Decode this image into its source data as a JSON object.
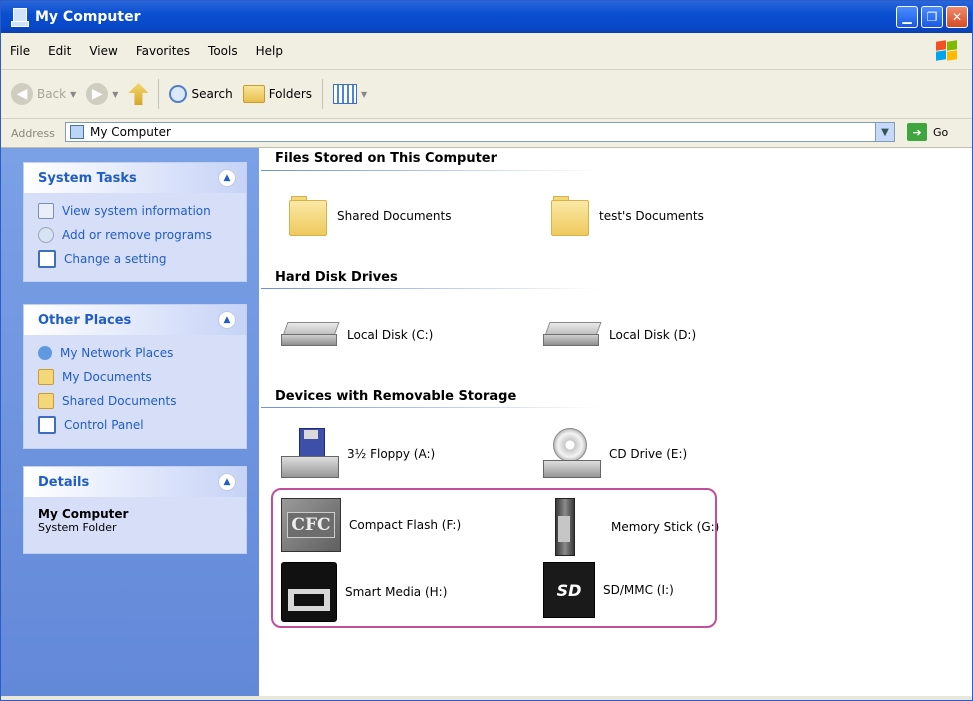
{
  "window": {
    "title": "My Computer"
  },
  "menu": {
    "items": [
      "File",
      "Edit",
      "View",
      "Favorites",
      "Tools",
      "Help"
    ]
  },
  "toolbar": {
    "back_label": "Back",
    "search_label": "Search",
    "folders_label": "Folders"
  },
  "address": {
    "label": "Address",
    "value": "My Computer",
    "go_label": "Go"
  },
  "sidebar": {
    "system_tasks": {
      "title": "System Tasks",
      "items": [
        "View system information",
        "Add or remove programs",
        "Change a setting"
      ]
    },
    "other_places": {
      "title": "Other Places",
      "items": [
        "My Network Places",
        "My Documents",
        "Shared Documents",
        "Control Panel"
      ]
    },
    "details": {
      "title": "Details",
      "name": "My Computer",
      "sub": "System Folder"
    }
  },
  "main": {
    "files_section": {
      "title": "Files Stored on This Computer",
      "items": [
        "Shared Documents",
        "test's Documents"
      ]
    },
    "hdd_section": {
      "title": "Hard Disk Drives",
      "items": [
        "Local Disk (C:)",
        "Local Disk (D:)"
      ]
    },
    "removable_section": {
      "title": "Devices with Removable Storage",
      "items": [
        "3½ Floppy (A:)",
        "CD Drive (E:)",
        "Compact Flash (F:)",
        "Memory Stick (G:)",
        "Smart Media (H:)",
        "SD/MMC (I:)"
      ]
    }
  },
  "icons": {
    "cf_label": "CFC",
    "sd_label": "SD"
  },
  "colors": {
    "titlebar": "#0a4fd1",
    "sidebar": "#6f94dc",
    "task_link": "#215dc6",
    "highlight": "#c04e9a"
  }
}
